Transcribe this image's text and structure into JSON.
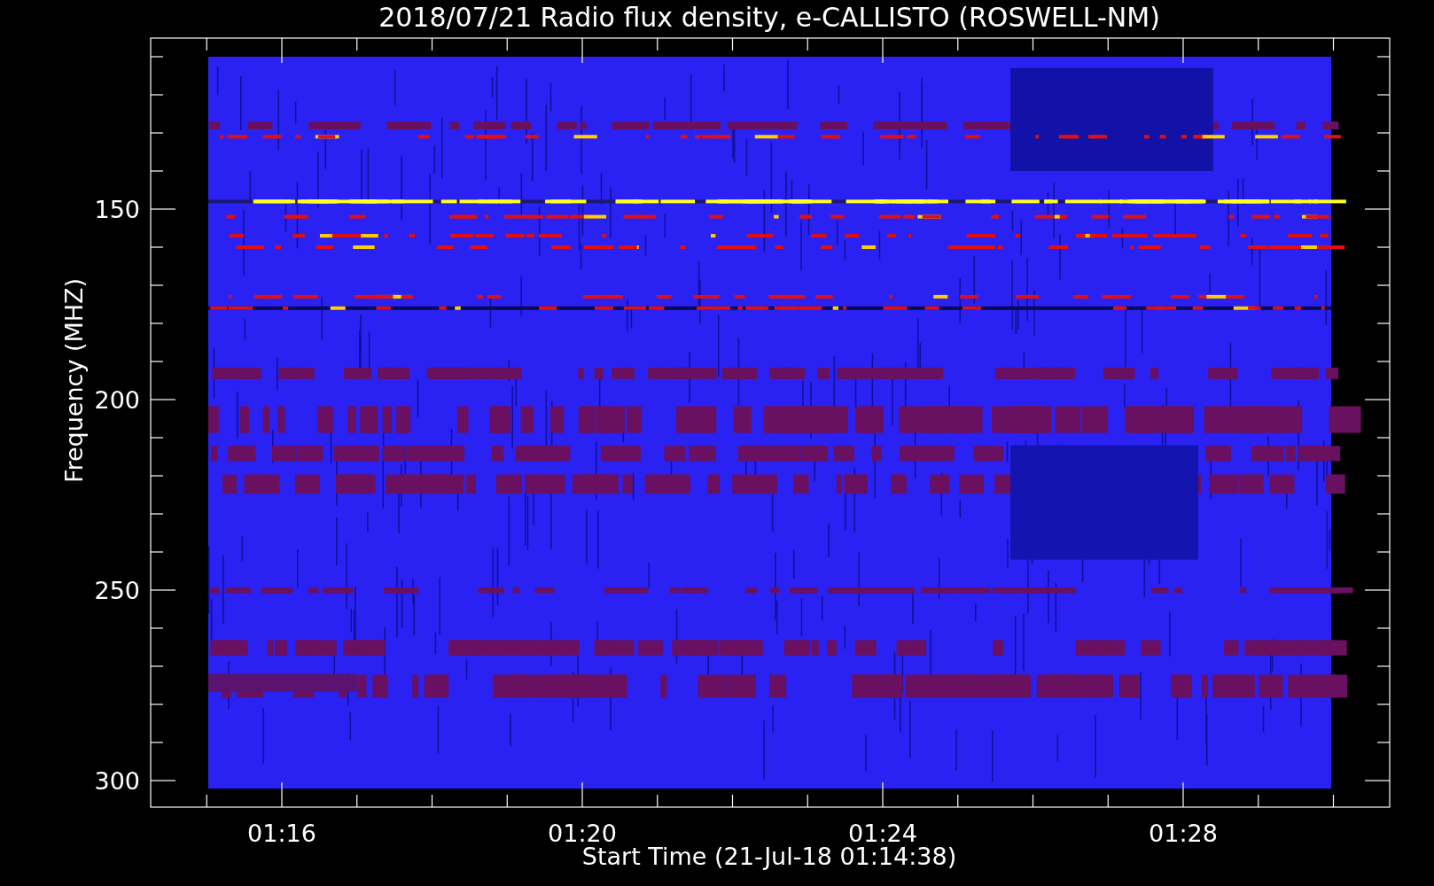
{
  "title": "2018/07/21  Radio flux density, e-CALLISTO (ROSWELL-NM)",
  "y_axis": {
    "label": "Frequency (MHZ)",
    "ticks": [
      "150",
      "200",
      "250",
      "300"
    ]
  },
  "x_axis": {
    "label": "Start Time (21-Jul-18 01:14:38)",
    "ticks": [
      "01:16",
      "01:20",
      "01:24",
      "01:28"
    ]
  }
}
